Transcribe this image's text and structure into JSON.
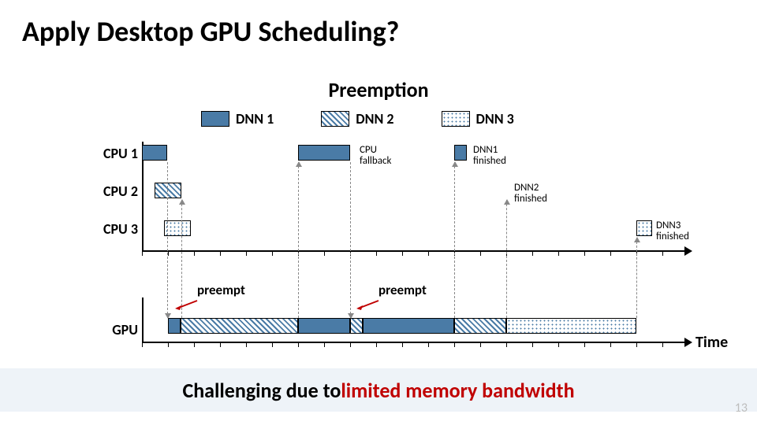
{
  "title": "Apply Desktop GPU Scheduling?",
  "subtitle": "Preemption",
  "legend": {
    "dnn1": "DNN 1",
    "dnn2": "DNN 2",
    "dnn3": "DNN 3"
  },
  "rows": {
    "cpu1": "CPU 1",
    "cpu2": "CPU 2",
    "cpu3": "CPU 3",
    "gpu": "GPU"
  },
  "annotations": {
    "cpu_fallback": "CPU\nfallback",
    "dnn1_finished": "DNN1\nfinished",
    "dnn2_finished": "DNN2\nfinished",
    "dnn3_finished": "DNN3\nfinished",
    "preempt1": "preempt",
    "preempt2": "preempt",
    "time_axis": "Time"
  },
  "caption": {
    "lead": "Challenging due to ",
    "emph": "limited memory bandwidth"
  },
  "page_number": "13",
  "chart_data": {
    "type": "gantt",
    "title": "Preemption",
    "xlabel": "Time",
    "x_unit": "ticks",
    "xlim": [
      0,
      20
    ],
    "tracks": [
      {
        "name": "CPU 1",
        "segments": [
          {
            "series": "DNN 1",
            "start": 0,
            "end": 1
          },
          {
            "series": "DNN 1",
            "start": 6,
            "end": 8,
            "note": "CPU fallback"
          },
          {
            "series": "DNN 1",
            "start": 12,
            "end": 12.5,
            "note": "DNN1 finished"
          }
        ]
      },
      {
        "name": "CPU 2",
        "segments": [
          {
            "series": "DNN 2",
            "start": 0.5,
            "end": 1.5,
            "note": "DNN2 finished at 14"
          }
        ]
      },
      {
        "name": "CPU 3",
        "segments": [
          {
            "series": "DNN 3",
            "start": 0.8,
            "end": 1.8
          },
          {
            "series": "DNN 3",
            "start": 19,
            "end": 19.6,
            "note": "DNN3 finished"
          }
        ]
      },
      {
        "name": "GPU",
        "segments": [
          {
            "series": "DNN 1",
            "start": 1,
            "end": 1.5,
            "note": "preempt"
          },
          {
            "series": "DNN 2",
            "start": 1.5,
            "end": 6
          },
          {
            "series": "DNN 1",
            "start": 6,
            "end": 8
          },
          {
            "series": "DNN 2",
            "start": 8,
            "end": 8.5,
            "note": "preempt"
          },
          {
            "series": "DNN 1",
            "start": 8.5,
            "end": 12
          },
          {
            "series": "DNN 2",
            "start": 12,
            "end": 14
          },
          {
            "series": "DNN 3",
            "start": 14,
            "end": 19
          }
        ]
      }
    ],
    "legend": [
      "DNN 1",
      "DNN 2",
      "DNN 3"
    ]
  }
}
